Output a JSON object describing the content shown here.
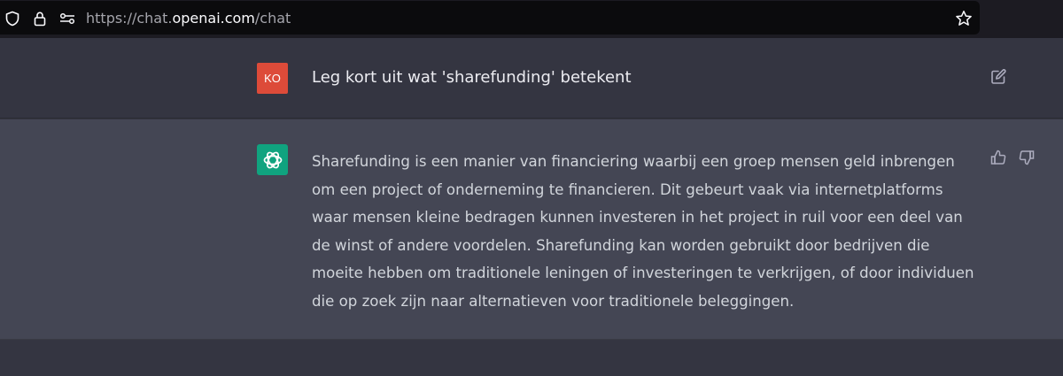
{
  "browser": {
    "url_prefix": "https://chat.",
    "url_domain": "openai.com",
    "url_path": "/chat",
    "icons": [
      "shield-icon",
      "lock-icon",
      "permissions-icon",
      "star-icon"
    ]
  },
  "conversation": {
    "user": {
      "avatar_initials": "KO",
      "avatar_color": "#dd4b39",
      "message": "Leg kort uit wat 'sharefunding' betekent"
    },
    "assistant": {
      "avatar_color": "#10a37f",
      "message": "Sharefunding is een manier van financiering waarbij een groep mensen geld inbrengen om een project of onderneming te financieren. Dit gebeurt vaak via internetplatforms waar mensen kleine bedragen kunnen investeren in het project in ruil voor een deel van de winst of andere voordelen. Sharefunding kan worden gebruikt door bedrijven die moeite hebben om traditionele leningen of investeringen te verkrijgen, of door individuen die op zoek zijn naar alternatieven voor traditionele beleggingen."
    }
  },
  "colors": {
    "user_row_bg": "#343541",
    "assistant_row_bg": "#444654",
    "text": "#d1d5db"
  }
}
